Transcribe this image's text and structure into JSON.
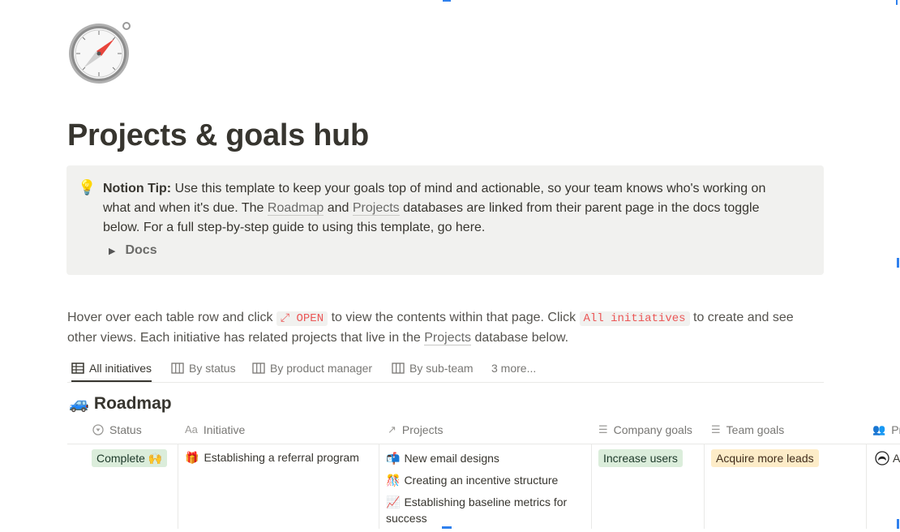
{
  "page": {
    "icon": "compass-icon",
    "title": "Projects & goals hub"
  },
  "callout": {
    "icon": "lightbulb-icon",
    "tip_label": "Notion Tip:",
    "text_1": " Use this template to keep your goals top of mind and actionable, so your team knows who's working on what and when it's due. The ",
    "link_roadmap": "Roadmap",
    "text_2": " and ",
    "link_projects": "Projects",
    "text_3": " databases are linked from their parent page in the docs toggle below. For a full step-by-step guide to using this template, go here.",
    "toggle_label": "Docs"
  },
  "description": {
    "text_1": "Hover over each table row and click ",
    "code_open": "⤢ OPEN",
    "text_2": " to view the contents within that page. Click ",
    "code_all": "All initiatives",
    "text_3": " to create and see other views. Each initiative has related projects that live in the ",
    "link_projects": "Projects",
    "text_4": " database below."
  },
  "views": {
    "tabs": [
      {
        "label": "All initiatives",
        "icon": "table-icon",
        "active": true
      },
      {
        "label": "By status",
        "icon": "board-icon"
      },
      {
        "label": "By product manager",
        "icon": "board-icon"
      },
      {
        "label": "By sub-team",
        "icon": "board-icon"
      },
      {
        "label": "3 more..."
      }
    ]
  },
  "database": {
    "icon": "car-icon",
    "title": "Roadmap",
    "columns": [
      {
        "label": "Status",
        "icon": "status-icon"
      },
      {
        "label": "Initiative",
        "icon": "text-aa-icon"
      },
      {
        "label": "Projects",
        "icon": "relation-arrow-icon"
      },
      {
        "label": "Company goals",
        "icon": "list-icon"
      },
      {
        "label": "Team goals",
        "icon": "list-icon"
      },
      {
        "label": "Pr",
        "icon": "people-icon"
      }
    ],
    "rows": [
      {
        "status": "Complete 🙌",
        "initiative": {
          "emoji": "🎁",
          "label": "Establishing a referral program"
        },
        "projects": [
          {
            "emoji": "📬",
            "label": "New email designs"
          },
          {
            "emoji": "🎊",
            "label": "Creating an incentive structure"
          },
          {
            "emoji": "📈",
            "label": "Establishing baseline metrics for success"
          }
        ],
        "company_goal": "Increase users",
        "team_goal": "Acquire more leads",
        "person_initial": "A"
      }
    ]
  },
  "colors": {
    "text": "#37352f",
    "muted": "#787774",
    "callout_bg": "#f1f1ef",
    "code_red": "#eb5757",
    "tag_green": "#dbeddb",
    "tag_yellow": "#fdecc8",
    "accent_blue": "#2f80ed"
  }
}
